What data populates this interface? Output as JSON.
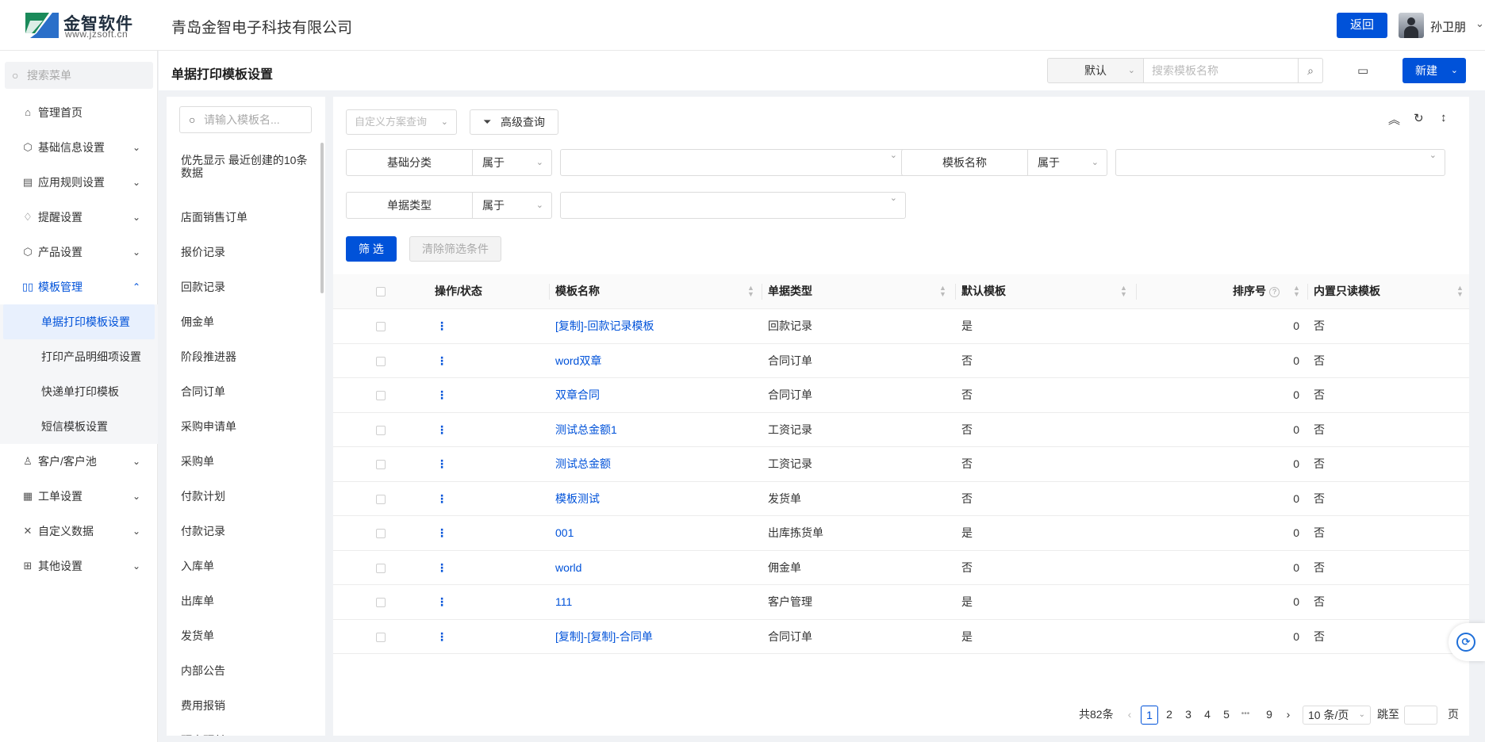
{
  "header": {
    "logo_cn": "金智软件",
    "logo_en": "www.jzsoft.cn",
    "company": "青岛金智电子科技有限公司",
    "back_label": "返回",
    "user_name": "孙卫朋"
  },
  "sidebar": {
    "search_placeholder": "搜索菜单",
    "items": [
      {
        "label": "管理首页",
        "icon": "home-icon"
      },
      {
        "label": "基础信息设置",
        "icon": "cube-icon"
      },
      {
        "label": "应用规则设置",
        "icon": "document-icon"
      },
      {
        "label": "提醒设置",
        "icon": "bell-icon"
      },
      {
        "label": "产品设置",
        "icon": "cube-icon"
      },
      {
        "label": "模板管理",
        "icon": "template-icon"
      },
      {
        "label": "客户/客户池",
        "icon": "customer-icon"
      },
      {
        "label": "工单设置",
        "icon": "ticket-icon"
      },
      {
        "label": "自定义数据",
        "icon": "tools-icon"
      },
      {
        "label": "其他设置",
        "icon": "grid-icon"
      }
    ],
    "submenu": [
      "单据打印模板设置",
      "打印产品明细项设置",
      "快递单打印模板",
      "短信模板设置"
    ]
  },
  "page": {
    "title": "单据打印模板设置",
    "default_select": "默认",
    "search_placeholder": "搜索模板名称",
    "new_label": "新建"
  },
  "left_list": {
    "search_placeholder": "请输入模板名...",
    "items": [
      "优先显示 最近创建的10条数据",
      "店面销售订单",
      "报价记录",
      "回款记录",
      "佣金单",
      "阶段推进器",
      "合同订单",
      "采购申请单",
      "采购单",
      "付款计划",
      "付款记录",
      "入库单",
      "出库单",
      "发货单",
      "内部公告",
      "费用报销",
      "预支预付"
    ]
  },
  "filters": {
    "custom_query": "自定义方案查询",
    "advanced_query": "高级查询",
    "conditions": [
      {
        "field": "基础分类",
        "op": "属于"
      },
      {
        "field": "模板名称",
        "op": "属于"
      },
      {
        "field": "单据类型",
        "op": "属于"
      }
    ],
    "filter_btn": "筛 选",
    "clear_btn": "清除筛选条件"
  },
  "table": {
    "headers": [
      "操作/状态",
      "模板名称",
      "单据类型",
      "默认模板",
      "排序号",
      "内置只读模板"
    ],
    "rows": [
      {
        "name": "[复制]-回款记录模板",
        "type": "回款记录",
        "default": "是",
        "sort": "0",
        "readonly": "否"
      },
      {
        "name": "word双章",
        "type": "合同订单",
        "default": "否",
        "sort": "0",
        "readonly": "否"
      },
      {
        "name": "双章合同",
        "type": "合同订单",
        "default": "否",
        "sort": "0",
        "readonly": "否"
      },
      {
        "name": "测试总金额1",
        "type": "工资记录",
        "default": "否",
        "sort": "0",
        "readonly": "否"
      },
      {
        "name": "测试总金额",
        "type": "工资记录",
        "default": "否",
        "sort": "0",
        "readonly": "否"
      },
      {
        "name": "模板测试",
        "type": "发货单",
        "default": "否",
        "sort": "0",
        "readonly": "否"
      },
      {
        "name": "001",
        "type": "出库拣货单",
        "default": "是",
        "sort": "0",
        "readonly": "否"
      },
      {
        "name": "world",
        "type": "佣金单",
        "default": "否",
        "sort": "0",
        "readonly": "否"
      },
      {
        "name": "111",
        "type": "客户管理",
        "default": "是",
        "sort": "0",
        "readonly": "否"
      },
      {
        "name": "[复制]-[复制]-合同单",
        "type": "合同订单",
        "default": "是",
        "sort": "0",
        "readonly": "否"
      }
    ]
  },
  "pagination": {
    "total": "共82条",
    "pages": [
      "1",
      "2",
      "3",
      "4",
      "5",
      "•••",
      "9"
    ],
    "current": "1",
    "page_size": "10 条/页",
    "goto_label": "跳至",
    "page_unit": "页"
  }
}
